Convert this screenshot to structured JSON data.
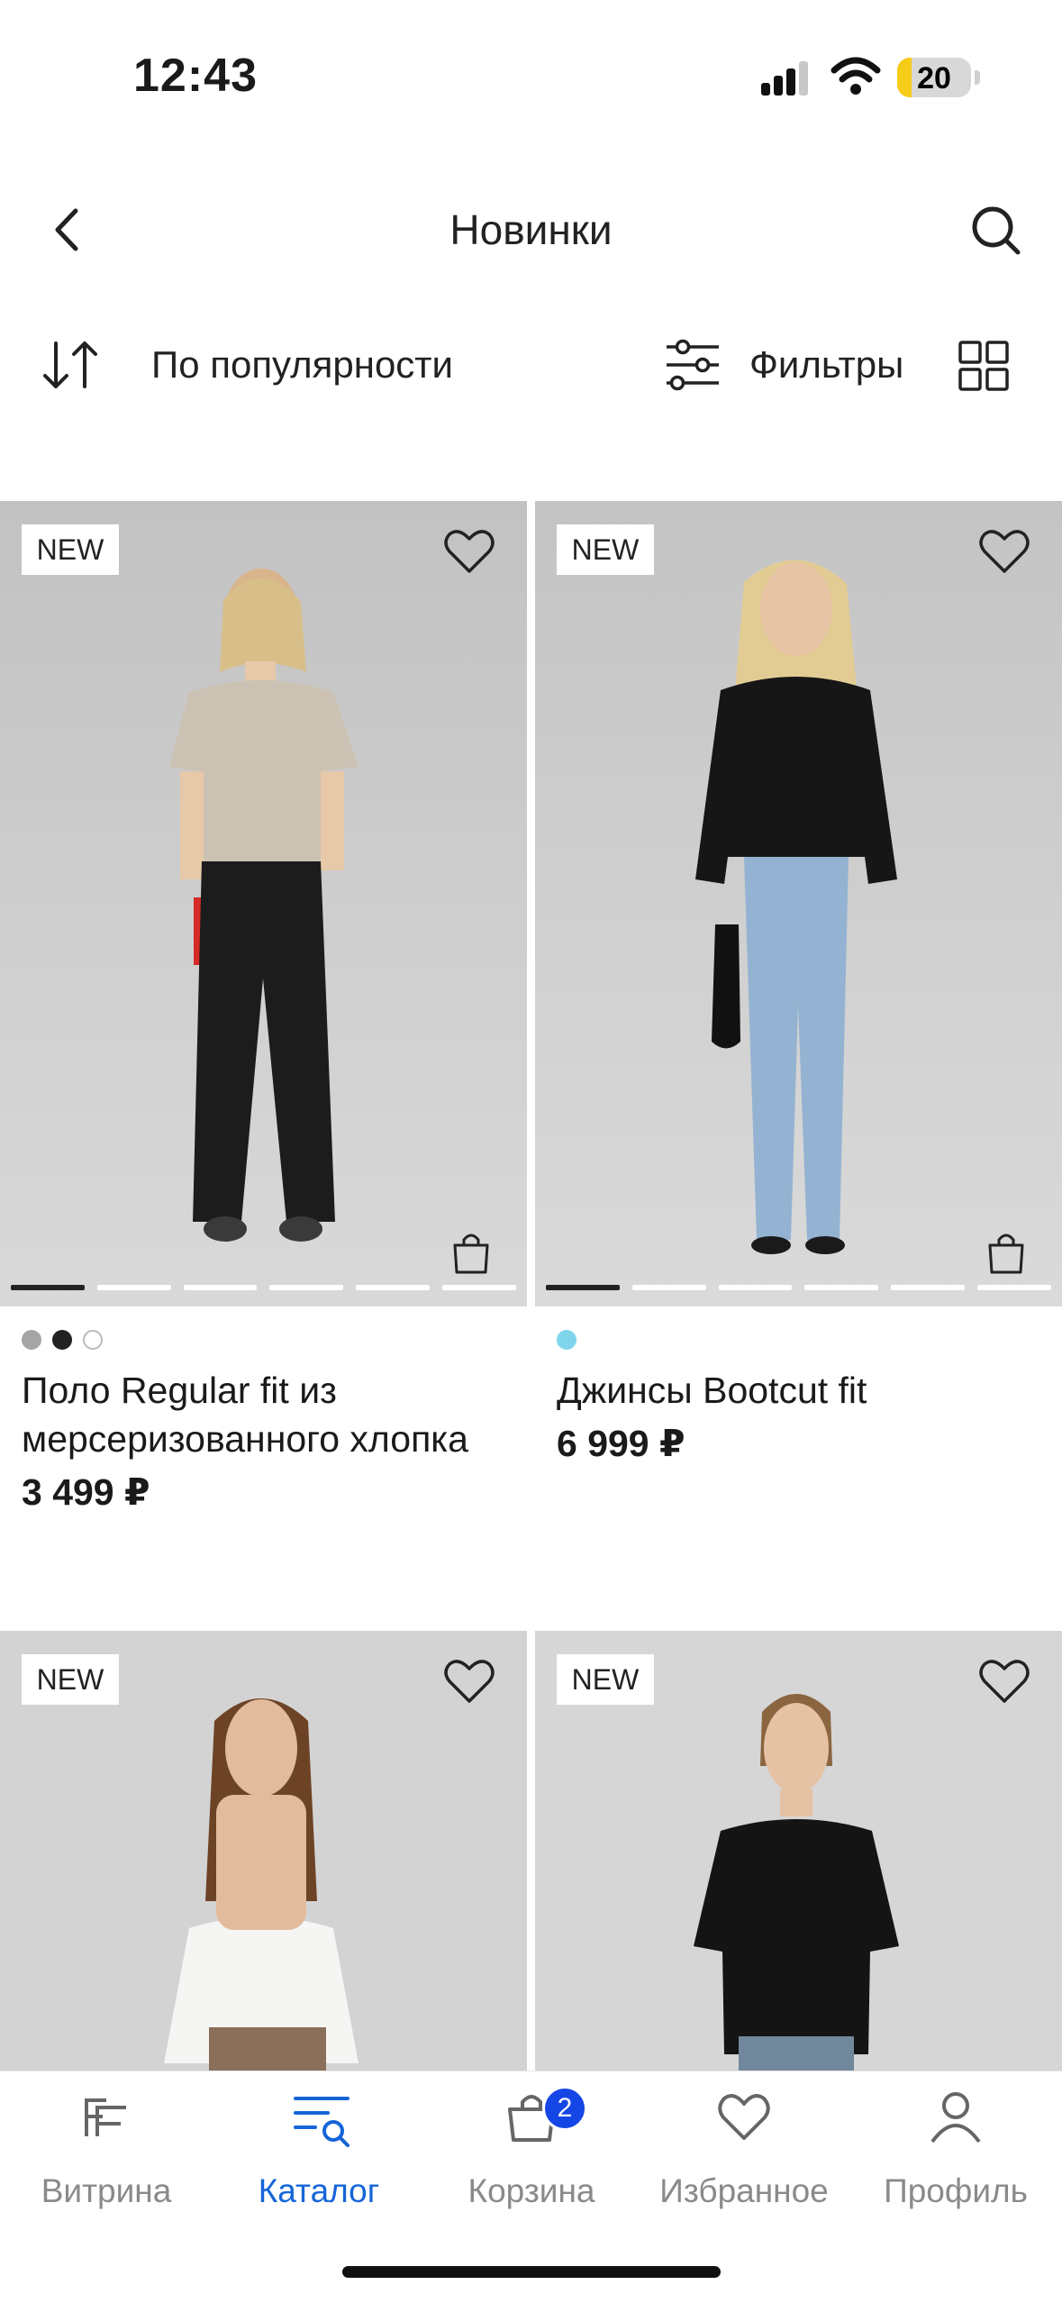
{
  "status_bar": {
    "time": "12:43",
    "battery": "20"
  },
  "header": {
    "title": "Новинки"
  },
  "toolbar": {
    "sort_label": "По популярности",
    "filter_label": "Фильтры"
  },
  "products": [
    {
      "badge": "NEW",
      "name": "Поло Regular fit из мерсеризованного хлопка",
      "price": "3 499 ₽",
      "swatches": [
        "#a5a5a5",
        "#222222",
        "#ffffff"
      ]
    },
    {
      "badge": "NEW",
      "name": "Джинсы Bootcut fit",
      "price": "6 999 ₽",
      "swatches": [
        "#7fd6ec"
      ]
    },
    {
      "badge": "NEW",
      "name": "",
      "price": ""
    },
    {
      "badge": "NEW",
      "name": "",
      "price": ""
    }
  ],
  "bottom_nav": {
    "items": [
      {
        "label": "Витрина",
        "icon": "ff-logo-icon"
      },
      {
        "label": "Каталог",
        "icon": "catalog-search-icon",
        "active": true
      },
      {
        "label": "Корзина",
        "icon": "cart-icon",
        "badge": "2"
      },
      {
        "label": "Избранное",
        "icon": "heart-icon"
      },
      {
        "label": "Профиль",
        "icon": "profile-icon"
      }
    ]
  },
  "colors": {
    "accent": "#1565d8",
    "badge": "#1546e6",
    "photo_bg": "#c9c9c9"
  }
}
